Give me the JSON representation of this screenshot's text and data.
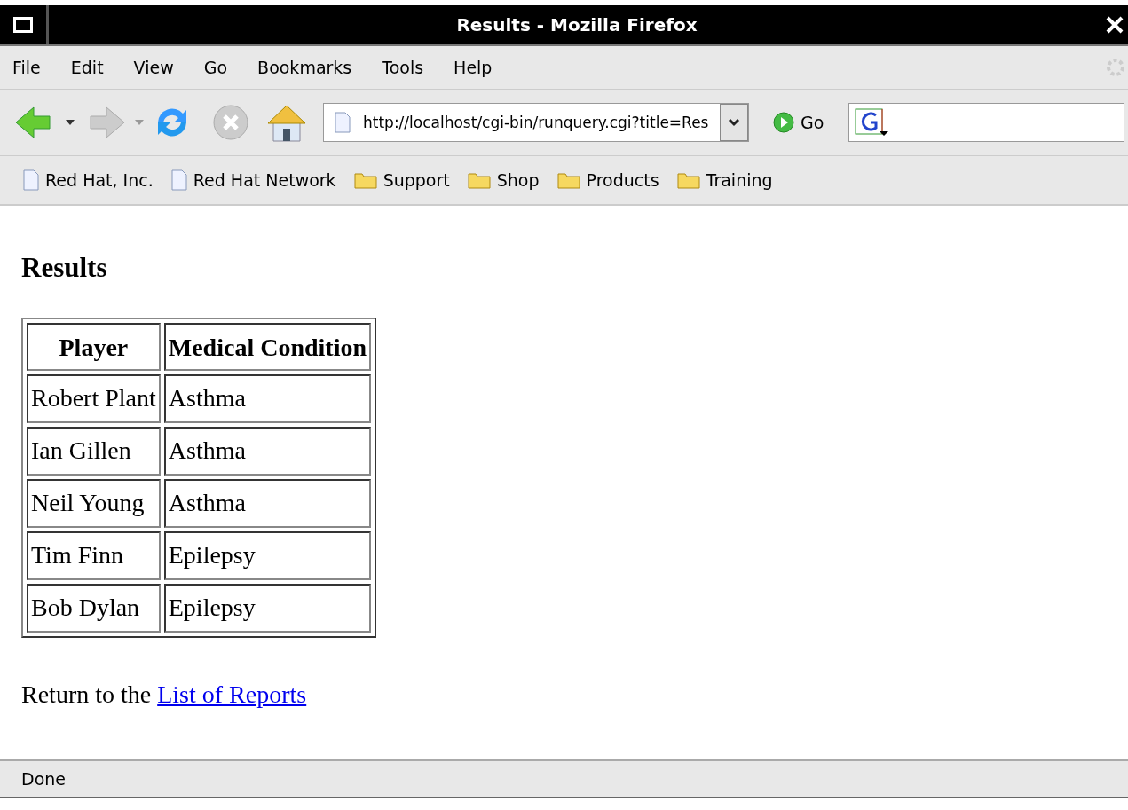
{
  "window": {
    "title": "Results - Mozilla Firefox"
  },
  "menu": [
    "File",
    "Edit",
    "View",
    "Go",
    "Bookmarks",
    "Tools",
    "Help"
  ],
  "address": {
    "value": "http://localhost/cgi-bin/runquery.cgi?title=Res"
  },
  "go_button": "Go",
  "bookmarks": [
    {
      "label": "Red Hat, Inc.",
      "kind": "page"
    },
    {
      "label": "Red Hat Network",
      "kind": "page"
    },
    {
      "label": "Support",
      "kind": "folder"
    },
    {
      "label": "Shop",
      "kind": "folder"
    },
    {
      "label": "Products",
      "kind": "folder"
    },
    {
      "label": "Training",
      "kind": "folder"
    }
  ],
  "page": {
    "heading": "Results",
    "table": {
      "columns": [
        "Player",
        "Medical Condition"
      ],
      "rows": [
        [
          "Robert Plant",
          "Asthma"
        ],
        [
          "Ian Gillen",
          "Asthma"
        ],
        [
          "Neil Young",
          "Asthma"
        ],
        [
          "Tim Finn",
          "Epilepsy"
        ],
        [
          "Bob Dylan",
          "Epilepsy"
        ]
      ]
    },
    "footer": {
      "text": "Return to the",
      "link": "List of Reports"
    }
  },
  "status_bar": "Done"
}
